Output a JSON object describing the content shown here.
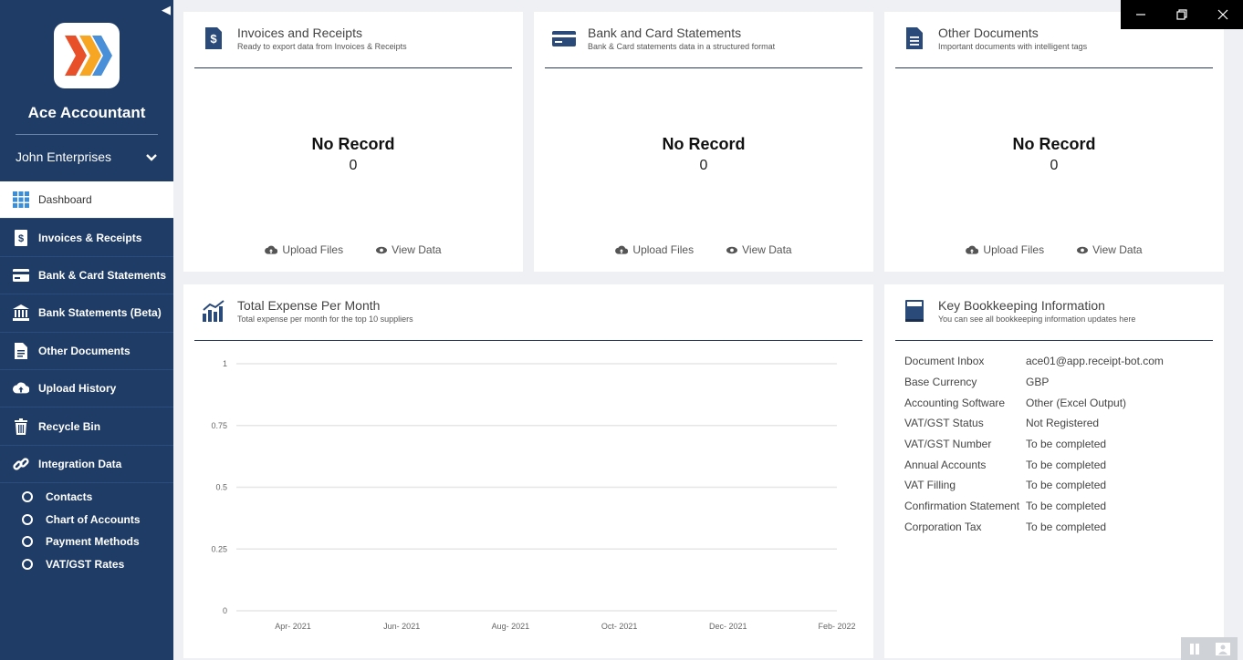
{
  "sidebar": {
    "app_name": "Ace Accountant",
    "company": "John Enterprises",
    "nav": [
      {
        "label": "Dashboard",
        "icon": "grid-icon",
        "active": true
      },
      {
        "label": "Invoices & Receipts",
        "icon": "dollar-document-icon"
      },
      {
        "label": "Bank & Card Statements",
        "icon": "credit-card-icon"
      },
      {
        "label": "Bank Statements (Beta)",
        "icon": "bank-icon"
      },
      {
        "label": "Other Documents",
        "icon": "document-icon"
      },
      {
        "label": "Upload History",
        "icon": "cloud-upload-icon"
      },
      {
        "label": "Recycle Bin",
        "icon": "trash-icon"
      },
      {
        "label": "Integration Data",
        "icon": "link-icon"
      }
    ],
    "sub_items": [
      "Contacts",
      "Chart of Accounts",
      "Payment Methods",
      "VAT/GST Rates"
    ]
  },
  "cards": [
    {
      "title": "Invoices and Receipts",
      "subtitle": "Ready to export data from Invoices & Receipts",
      "icon": "dollar-document-icon",
      "empty": "No Record",
      "count": "0",
      "upload": "Upload Files",
      "view": "View Data"
    },
    {
      "title": "Bank and Card Statements",
      "subtitle": "Bank & Card statements data in a structured format",
      "icon": "credit-card-icon",
      "empty": "No Record",
      "count": "0",
      "upload": "Upload Files",
      "view": "View Data"
    },
    {
      "title": "Other Documents",
      "subtitle": "Important documents with intelligent tags",
      "icon": "document-icon",
      "empty": "No Record",
      "count": "0",
      "upload": "Upload Files",
      "view": "View Data"
    }
  ],
  "expense": {
    "title": "Total Expense Per Month",
    "subtitle": "Total expense per month for the top 10 suppliers",
    "icon": "bar-chart-icon"
  },
  "chart_data": {
    "type": "line",
    "categories": [
      "Apr- 2021",
      "Jun- 2021",
      "Aug- 2021",
      "Oct- 2021",
      "Dec- 2021",
      "Feb- 2022"
    ],
    "series": [],
    "yticks": [
      "0",
      "0.25",
      "0.5",
      "0.75",
      "1"
    ],
    "ylim": [
      0,
      1
    ],
    "grid": true,
    "title": "",
    "xlabel": "",
    "ylabel": ""
  },
  "bookkeeping": {
    "title": "Key Bookkeeping Information",
    "subtitle": "You can see all bookkeeping information updates here",
    "icon": "book-icon",
    "rows": [
      {
        "key": "Document Inbox",
        "value": "ace01@app.receipt-bot.com"
      },
      {
        "key": "Base Currency",
        "value": "GBP"
      },
      {
        "key": "Accounting Software",
        "value": "Other (Excel Output)"
      },
      {
        "key": "VAT/GST Status",
        "value": "Not Registered"
      },
      {
        "key": "VAT/GST Number",
        "value": "To be completed"
      },
      {
        "key": "Annual Accounts",
        "value": "To be completed"
      },
      {
        "key": "VAT Filling",
        "value": "To be completed"
      },
      {
        "key": "Confirmation Statement",
        "value": "To be completed"
      },
      {
        "key": "Corporation Tax",
        "value": "To be completed"
      }
    ]
  },
  "colors": {
    "sidebar": "#1f3c66",
    "accent": "#2a4a7a"
  }
}
